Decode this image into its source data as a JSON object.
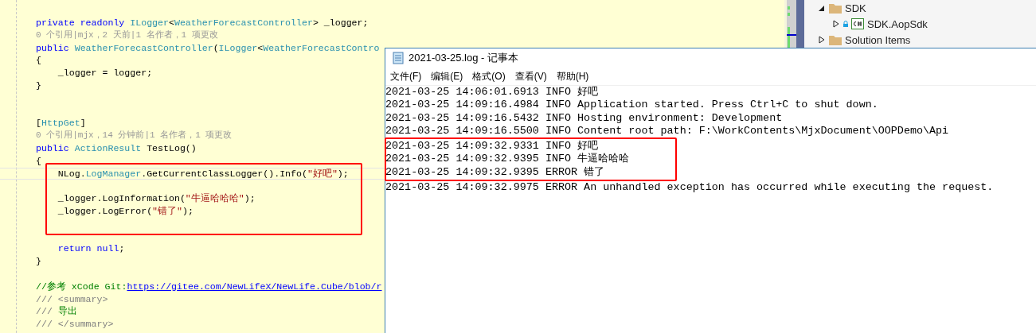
{
  "editor": {
    "lines": [
      {
        "kind": "code",
        "segments": [
          {
            "kind": "keyword",
            "text": "private readonly "
          },
          {
            "kind": "type",
            "text": "ILogger"
          },
          {
            "kind": "plain",
            "text": "<"
          },
          {
            "kind": "type",
            "text": "WeatherForecastController"
          },
          {
            "kind": "plain",
            "text": "> _logger;"
          }
        ]
      },
      {
        "kind": "codelens",
        "segments": [
          {
            "kind": "lens",
            "text": "0 个引用|mjx，2 天前|1 名作者，1 项更改"
          }
        ]
      },
      {
        "kind": "code",
        "segments": [
          {
            "kind": "keyword",
            "text": "public "
          },
          {
            "kind": "type",
            "text": "WeatherForecastController"
          },
          {
            "kind": "plain",
            "text": "("
          },
          {
            "kind": "type",
            "text": "ILogger"
          },
          {
            "kind": "plain",
            "text": "<"
          },
          {
            "kind": "type",
            "text": "WeatherForecastContro"
          }
        ]
      },
      {
        "kind": "code",
        "segments": [
          {
            "kind": "plain",
            "text": "{"
          }
        ]
      },
      {
        "kind": "code",
        "segments": [
          {
            "kind": "plain",
            "text": "    _logger = logger;"
          }
        ]
      },
      {
        "kind": "code",
        "segments": [
          {
            "kind": "plain",
            "text": "}"
          }
        ]
      },
      {
        "kind": "blank"
      },
      {
        "kind": "blank"
      },
      {
        "kind": "code",
        "segments": [
          {
            "kind": "plain",
            "text": "["
          },
          {
            "kind": "type",
            "text": "HttpGet"
          },
          {
            "kind": "plain",
            "text": "]"
          }
        ]
      },
      {
        "kind": "codelens",
        "segments": [
          {
            "kind": "lens",
            "text": "0 个引用|mjx，14 分钟前|1 名作者，1 项更改"
          }
        ]
      },
      {
        "kind": "code",
        "segments": [
          {
            "kind": "keyword",
            "text": "public "
          },
          {
            "kind": "type",
            "text": "ActionResult"
          },
          {
            "kind": "plain",
            "text": " TestLog()"
          }
        ]
      },
      {
        "kind": "code",
        "segments": [
          {
            "kind": "plain",
            "text": "{"
          }
        ]
      },
      {
        "kind": "code",
        "highlighted": true,
        "current": true,
        "segments": [
          {
            "kind": "plain",
            "text": "    NLog."
          },
          {
            "kind": "type",
            "text": "LogManager"
          },
          {
            "kind": "plain",
            "text": ".GetCurrentClassLogger().Info("
          },
          {
            "kind": "string",
            "text": "\"好吧\""
          },
          {
            "kind": "plain",
            "text": ");"
          }
        ]
      },
      {
        "kind": "blank",
        "highlighted": true
      },
      {
        "kind": "code",
        "highlighted": true,
        "segments": [
          {
            "kind": "plain",
            "text": "    _logger.LogInformation("
          },
          {
            "kind": "string",
            "text": "\"牛逼哈哈哈\""
          },
          {
            "kind": "plain",
            "text": ");"
          }
        ]
      },
      {
        "kind": "code",
        "highlighted": true,
        "segments": [
          {
            "kind": "plain",
            "text": "    _logger.LogError("
          },
          {
            "kind": "string",
            "text": "\"错了\""
          },
          {
            "kind": "plain",
            "text": ");"
          }
        ]
      },
      {
        "kind": "blank",
        "highlighted": true
      },
      {
        "kind": "blank"
      },
      {
        "kind": "code",
        "segments": [
          {
            "kind": "keyword",
            "text": "    return null"
          },
          {
            "kind": "plain",
            "text": ";"
          }
        ]
      },
      {
        "kind": "code",
        "segments": [
          {
            "kind": "plain",
            "text": "}"
          }
        ]
      },
      {
        "kind": "blank"
      },
      {
        "kind": "code",
        "segments": [
          {
            "kind": "comment",
            "text": "//参考 xCode Git:"
          },
          {
            "kind": "link",
            "text": "https://gitee.com/NewLifeX/NewLife.Cube/blob/r"
          }
        ]
      },
      {
        "kind": "code",
        "segments": [
          {
            "kind": "doc",
            "text": "/// <summary>"
          }
        ]
      },
      {
        "kind": "code",
        "segments": [
          {
            "kind": "doc",
            "text": "/// "
          },
          {
            "kind": "comment",
            "text": "导出"
          }
        ]
      },
      {
        "kind": "code",
        "segments": [
          {
            "kind": "doc",
            "text": "/// </summary>"
          }
        ]
      }
    ]
  },
  "solution_explorer": {
    "items": [
      {
        "label": "SDK",
        "kind": "folder",
        "expanded": true,
        "children": [
          {
            "label": "SDK.AopSdk",
            "kind": "csharp-project",
            "expanded": false
          }
        ]
      },
      {
        "label": "Solution Items",
        "kind": "folder",
        "expanded": false
      }
    ]
  },
  "notepad": {
    "title": "2021-03-25.log - 记事本",
    "menu": [
      "文件(F)",
      "编辑(E)",
      "格式(O)",
      "查看(V)",
      "帮助(H)"
    ],
    "lines": [
      {
        "text": "2021-03-25 14:06:01.6913 INFO 好吧",
        "highlighted": false
      },
      {
        "text": "2021-03-25 14:09:16.4984 INFO Application started. Press Ctrl+C to shut down.",
        "highlighted": false
      },
      {
        "text": "2021-03-25 14:09:16.5432 INFO Hosting environment: Development",
        "highlighted": false
      },
      {
        "text": "2021-03-25 14:09:16.5500 INFO Content root path: F:\\WorkContents\\MjxDocument\\OOPDemo\\Api",
        "highlighted": false
      },
      {
        "text": "2021-03-25 14:09:32.9331 INFO 好吧",
        "highlighted": true
      },
      {
        "text": "2021-03-25 14:09:32.9395 INFO 牛逼哈哈哈",
        "highlighted": true
      },
      {
        "text": "2021-03-25 14:09:32.9395 ERROR 错了",
        "highlighted": true
      },
      {
        "text": "2021-03-25 14:09:32.9975 ERROR An unhandled exception has occurred while executing the request.",
        "highlighted": false
      }
    ]
  }
}
